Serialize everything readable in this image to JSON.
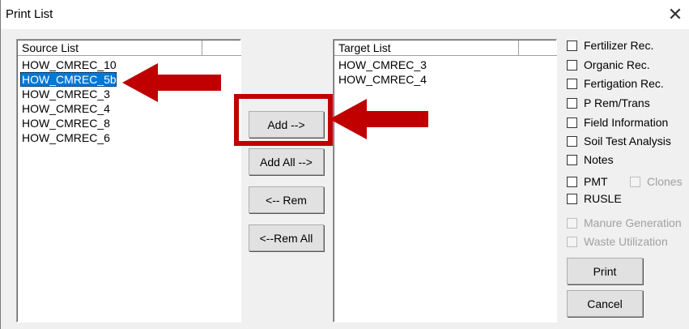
{
  "window": {
    "title": "Print List"
  },
  "source_list": {
    "header": "Source List",
    "items": [
      "HOW_CMREC_10",
      "HOW_CMREC_5b",
      "HOW_CMREC_3",
      "HOW_CMREC_4",
      "HOW_CMREC_8",
      "HOW_CMREC_6"
    ],
    "selected_index": 1
  },
  "target_list": {
    "header": "Target List",
    "items": [
      "HOW_CMREC_3",
      "HOW_CMREC_4"
    ]
  },
  "buttons": {
    "add": "Add  -->",
    "add_all": "Add  All  -->",
    "rem": "<-- Rem",
    "rem_all": "<--Rem All",
    "print": "Print",
    "cancel": "Cancel"
  },
  "options": [
    {
      "label": "Fertilizer Rec.",
      "checked": false,
      "enabled": true
    },
    {
      "label": "Organic Rec.",
      "checked": false,
      "enabled": true
    },
    {
      "label": "Fertigation Rec.",
      "checked": false,
      "enabled": true
    },
    {
      "label": "P Rem/Trans",
      "checked": false,
      "enabled": true
    },
    {
      "label": "Field Information",
      "checked": false,
      "enabled": true
    },
    {
      "label": "Soil Test Analysis",
      "checked": false,
      "enabled": true
    },
    {
      "label": "Notes",
      "checked": false,
      "enabled": true
    },
    {
      "label": "PMT",
      "checked": false,
      "enabled": true
    },
    {
      "label": "RUSLE",
      "checked": false,
      "enabled": true
    },
    {
      "label": "Manure Generation",
      "checked": false,
      "enabled": false
    },
    {
      "label": "Waste Utilization",
      "checked": false,
      "enabled": false
    }
  ],
  "clones_option": {
    "label": "Clones",
    "checked": false,
    "enabled": false
  },
  "annotation": {
    "color": "#c00000"
  }
}
